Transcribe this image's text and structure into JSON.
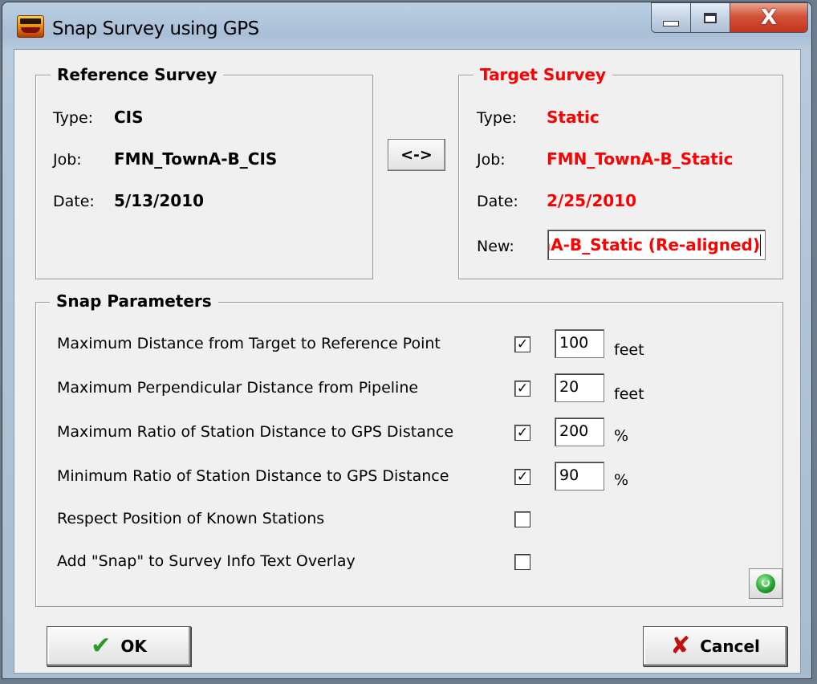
{
  "window": {
    "title": "Snap Survey using GPS",
    "app_icon": "app-logo-icon",
    "controls": {
      "minimize": "minimize-icon",
      "maximize": "maximize-icon",
      "close": "close-icon",
      "close_glyph": "X"
    }
  },
  "reference": {
    "title": "Reference Survey",
    "type_label": "Type:",
    "type_value": "CIS",
    "job_label": "Job:",
    "job_value": "FMN_TownA-B_CIS",
    "date_label": "Date:",
    "date_value": "5/13/2010"
  },
  "swap_button": {
    "label": "<->"
  },
  "target": {
    "title": "Target Survey",
    "type_label": "Type:",
    "type_value": "Static",
    "job_label": "Job:",
    "job_value": "FMN_TownA-B_Static",
    "date_label": "Date:",
    "date_value": "2/25/2010",
    "new_label": "New:",
    "new_value": "FMN_TownA-B_Static (Re-aligned)"
  },
  "snap": {
    "title": "Snap Parameters",
    "params": [
      {
        "label": "Maximum Distance from Target to Reference Point",
        "checked": true,
        "value": "100",
        "unit": "feet"
      },
      {
        "label": "Maximum Perpendicular Distance from Pipeline",
        "checked": true,
        "value": "20",
        "unit": "feet"
      },
      {
        "label": "Maximum Ratio of Station Distance to GPS Distance",
        "checked": true,
        "value": "200",
        "unit": "%"
      },
      {
        "label": "Minimum Ratio of Station Distance to GPS Distance",
        "checked": true,
        "value": "90",
        "unit": "%"
      },
      {
        "label": "Respect Position of Known Stations",
        "checked": false
      },
      {
        "label": "Add \"Snap\" to Survey Info Text Overlay",
        "checked": false
      }
    ],
    "check_mark": "✓",
    "reset_icon": "power-reset-icon"
  },
  "buttons": {
    "ok": "OK",
    "ok_icon": "✔",
    "cancel": "Cancel",
    "cancel_icon": "✘"
  },
  "colors": {
    "target_text": "#ff0000",
    "ok_check": "#2a9a24",
    "cancel_x": "#c11010"
  }
}
